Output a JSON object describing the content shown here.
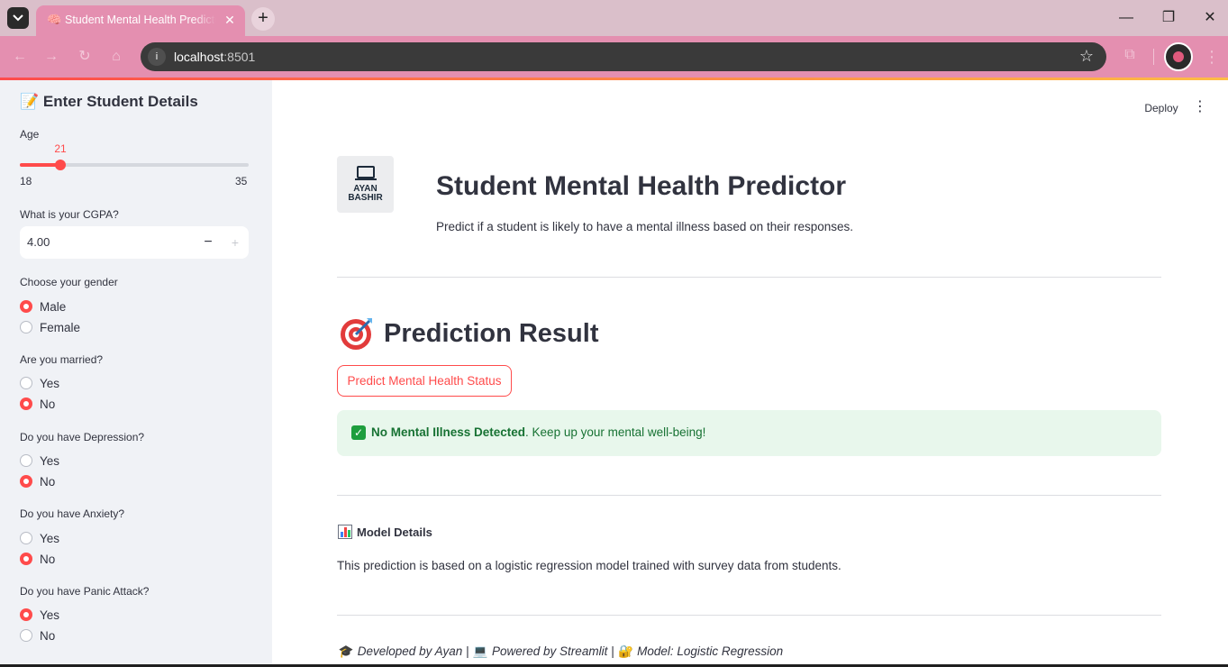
{
  "browser": {
    "tab_title": "Student Mental Health Predictor",
    "tab_favicon": "🧠",
    "url_host": "localhost",
    "url_port": ":8501"
  },
  "sidebar": {
    "header": "📝 Enter Student Details",
    "age": {
      "label": "Age",
      "value": "21",
      "min": "18",
      "max": "35",
      "fraction": 0.1765
    },
    "cgpa": {
      "label": "What is your CGPA?",
      "value": "4.00",
      "minus": "−",
      "plus": "+"
    },
    "gender": {
      "label": "Choose your gender",
      "options": [
        "Male",
        "Female"
      ],
      "selected": "Male"
    },
    "married": {
      "label": "Are you married?",
      "options": [
        "Yes",
        "No"
      ],
      "selected": "No"
    },
    "depression": {
      "label": "Do you have Depression?",
      "options": [
        "Yes",
        "No"
      ],
      "selected": "No"
    },
    "anxiety": {
      "label": "Do you have Anxiety?",
      "options": [
        "Yes",
        "No"
      ],
      "selected": "No"
    },
    "panic": {
      "label": "Do you have Panic Attack?",
      "options": [
        "Yes",
        "No"
      ],
      "selected": "Yes"
    }
  },
  "main": {
    "deploy_label": "Deploy",
    "logo_line1": "AYAN",
    "logo_line2": "BASHIR",
    "title": "Student Mental Health Predictor",
    "subtitle": "Predict if a student is likely to have a mental illness based on their responses.",
    "prediction_title": "Prediction Result",
    "predict_button": "Predict Mental Health Status",
    "result_bold": "No Mental Illness Detected",
    "result_rest": ". Keep up your mental well-being!",
    "details_title": "Model Details",
    "details_text": "This prediction is based on a logistic regression model trained with survey data from students.",
    "footer_developed": "Developed by Ayan",
    "footer_powered": "Powered by Streamlit",
    "footer_model": "Model: Logistic Regression",
    "footer_sep": " | "
  },
  "colors": {
    "accent": "#ff4b4b",
    "success_bg": "#e8f7ec",
    "success_text": "#177233",
    "sidebar_bg": "#f0f2f6",
    "browser_pink": "#e48fb0"
  }
}
